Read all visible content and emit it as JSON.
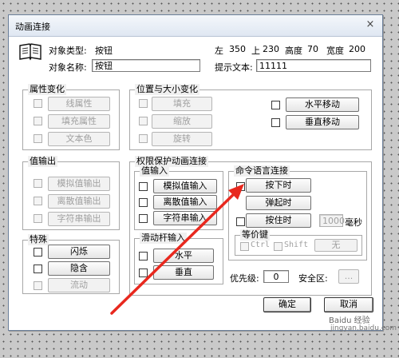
{
  "window": {
    "title": "动画连接",
    "close_glyph": "×"
  },
  "object": {
    "type_label": "对象类型:",
    "type_value": "按钮",
    "name_label": "对象名称:",
    "name_value": "按钮",
    "left_label": "左",
    "left_value": "350",
    "top_label": "上",
    "top_value": "230",
    "height_label": "高度",
    "height_value": "70",
    "width_label": "宽度",
    "width_value": "200",
    "hint_label": "提示文本:",
    "hint_value": "11111"
  },
  "attr_change": {
    "title": "属性变化",
    "items": [
      "线属性",
      "填充属性",
      "文本色"
    ]
  },
  "pos_size": {
    "title": "位置与大小变化",
    "left_items": [
      "填充",
      "缩放",
      "旋转"
    ],
    "right_items": [
      "水平移动",
      "垂直移动"
    ]
  },
  "value_output": {
    "title": "值输出",
    "items": [
      "模拟值输出",
      "离散值输出",
      "字符串输出"
    ]
  },
  "special": {
    "title": "特殊",
    "items": [
      "闪烁",
      "隐含",
      "流动"
    ]
  },
  "perm": {
    "title": "权限保护动画连接",
    "value_input": {
      "title": "值输入",
      "items": [
        "模拟值输入",
        "离散值输入",
        "字符串输入"
      ]
    },
    "slider_input": {
      "title": "滑动杆输入",
      "items": [
        "水平",
        "垂直"
      ]
    }
  },
  "command": {
    "title": "命令语言连接",
    "press": "按下时",
    "release": "弹起时",
    "hold": "按住时",
    "hold_ms_value": "1000",
    "hold_unit": "毫秒",
    "hotkey_title": "等价键",
    "ctrl": "Ctrl",
    "shift": "Shift",
    "none": "无"
  },
  "priority_label": "优先级:",
  "priority_value": "0",
  "security_label": "安全区:",
  "security_button": "...",
  "ok": "确定",
  "cancel": "取消",
  "watermark": "Baidu 经验",
  "watermark_sub": "jingyan.baidu.com"
}
